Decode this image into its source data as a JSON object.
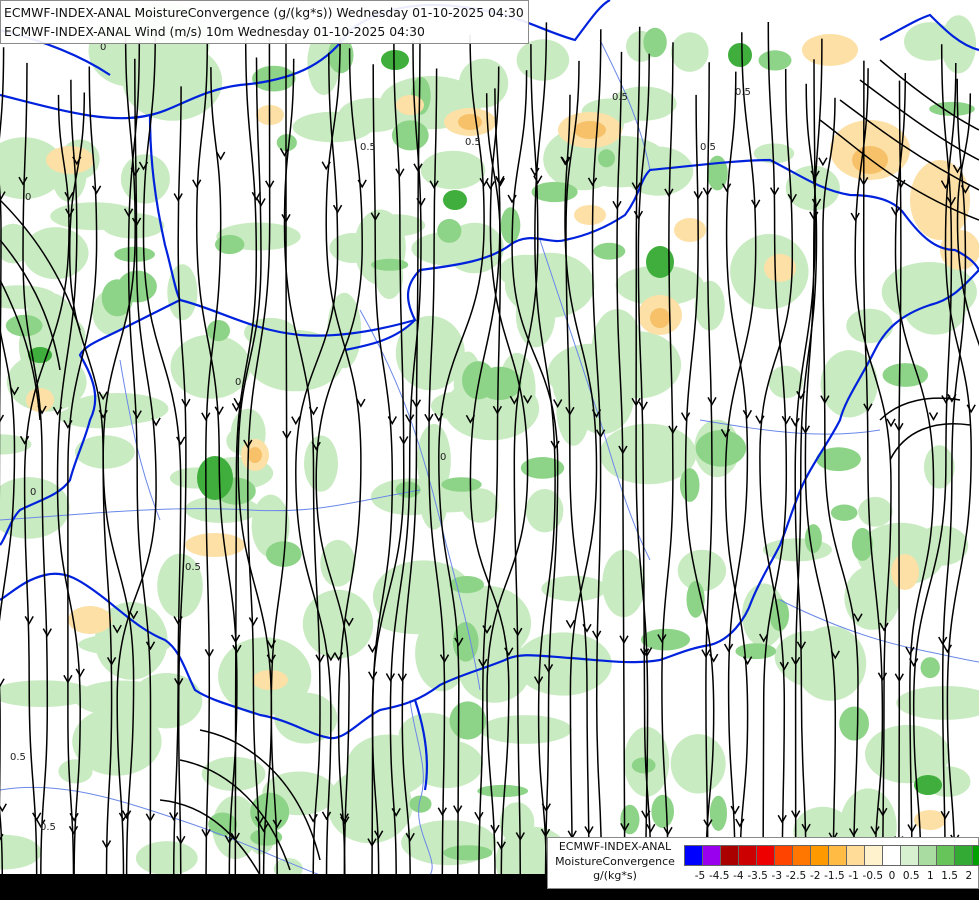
{
  "titles": {
    "line1": "ECMWF-INDEX-ANAL MoistureConvergence (g/(kg*s)) Wednesday 01-10-2025 04:30",
    "line2": "ECMWF-INDEX-ANAL Wind (m/s) 10m Wednesday 01-10-2025 04:30"
  },
  "legend": {
    "line1": "ECMWF-INDEX-ANAL",
    "line2": "MoistureConvergence",
    "line3": "g/(kg*s)",
    "colors": [
      "#0000ff",
      "#9900ee",
      "#aa0000",
      "#cc0000",
      "#ee0000",
      "#ff4400",
      "#ff7700",
      "#ff9900",
      "#ffbb44",
      "#ffdd99",
      "#fff2cc",
      "#ffffff",
      "#d6f0d0",
      "#a8dca0",
      "#66c45a",
      "#33aa33",
      "#00a000"
    ],
    "ticks": [
      "-5",
      "-4.5",
      "-4",
      "-3.5",
      "-3",
      "-2.5",
      "-2",
      "-1.5",
      "-1",
      "-0.5",
      "0",
      "0.5",
      "1",
      "1.5",
      "2"
    ]
  },
  "contour_labels": [
    "0.5",
    "0.5",
    "0.5",
    "0.5",
    "0.5",
    "0",
    "0",
    "0",
    "0",
    "0.5",
    "0.5",
    "0",
    "0.5"
  ],
  "map_colors": {
    "background": "#ffffff",
    "green_light": "#c9ebc1",
    "green_mid": "#8ed488",
    "green_dark": "#3fae3c",
    "orange_light": "#fde0a6",
    "orange_mid": "#f7c16a",
    "border": "#0022dd",
    "river": "#6a88e8",
    "streamline": "#000000",
    "sea_strip": "#000000"
  }
}
